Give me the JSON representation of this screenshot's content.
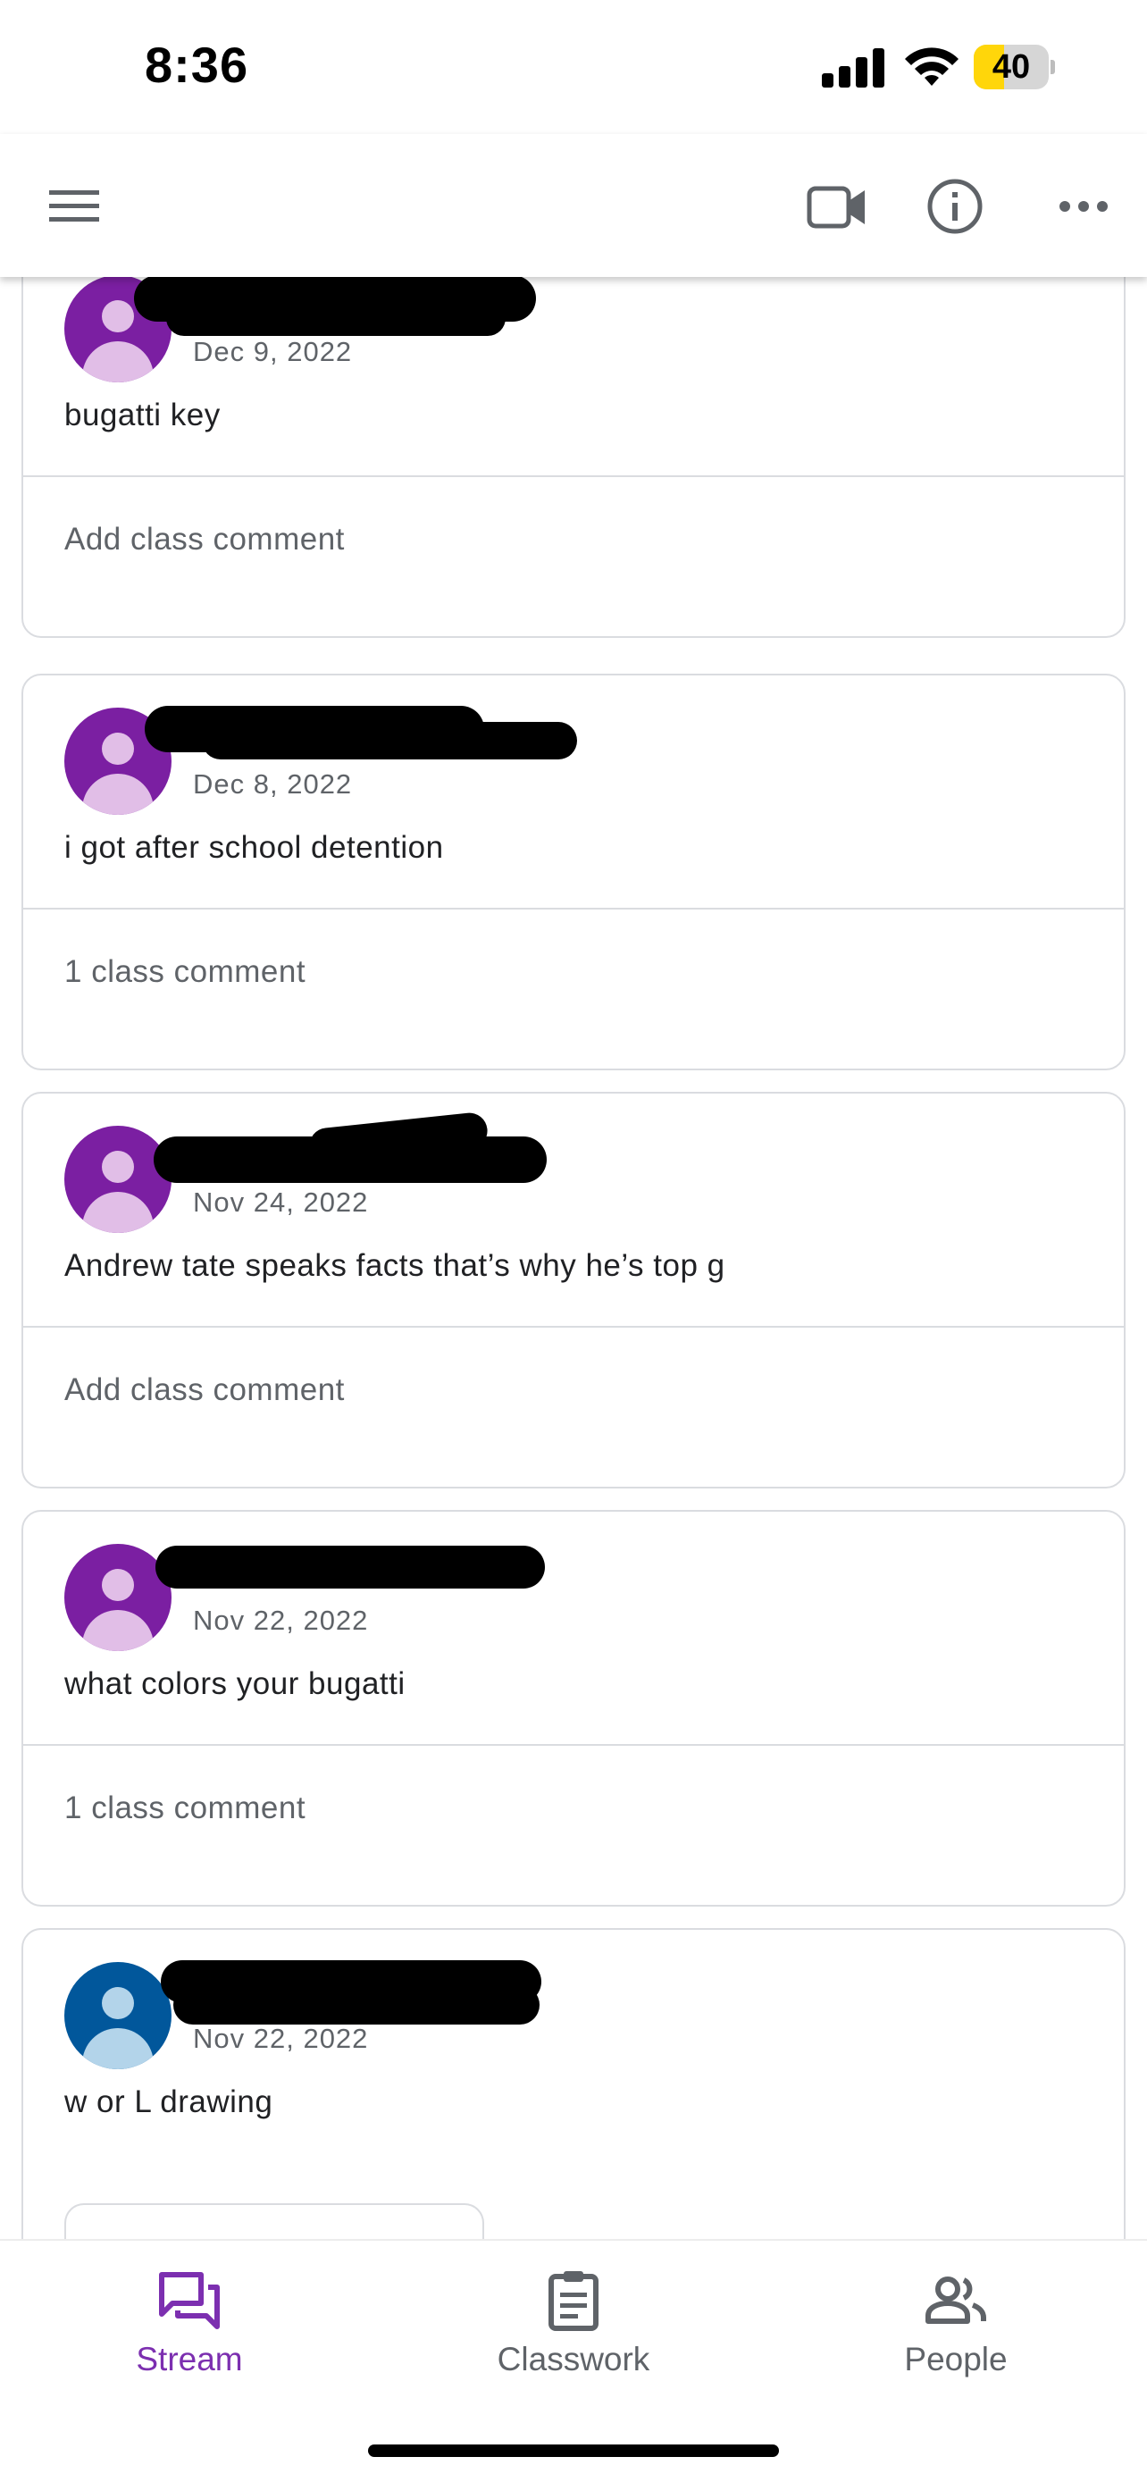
{
  "status_bar": {
    "time": "8:36",
    "battery_level": "40"
  },
  "app_bar": {
    "icons": [
      "menu-icon",
      "video-camera-icon",
      "info-icon",
      "more-horizontal-icon"
    ]
  },
  "posts": [
    {
      "date": "Dec 9, 2022",
      "text": "bugatti key",
      "footer": "Add class comment",
      "avatar_color": "#7b1fa2",
      "avatar_person_color": "#e1bee7"
    },
    {
      "date": "Dec 8, 2022",
      "text": "i got after school detention",
      "footer": "1 class comment",
      "avatar_color": "#7b1fa2",
      "avatar_person_color": "#e1bee7"
    },
    {
      "date": "Nov 24, 2022",
      "text": "Andrew tate speaks facts that’s why he’s top g",
      "footer": "Add class comment",
      "avatar_color": "#7b1fa2",
      "avatar_person_color": "#e1bee7"
    },
    {
      "date": "Nov 22, 2022",
      "text": "what colors your bugatti",
      "footer": "1 class comment",
      "avatar_color": "#7b1fa2",
      "avatar_person_color": "#e1bee7"
    },
    {
      "date": "Nov 22, 2022",
      "text": "w or L drawing",
      "footer": "",
      "avatar_color": "#01579b",
      "avatar_person_color": "#b3d4ea"
    }
  ],
  "bottom_nav": {
    "items": [
      {
        "label": "Stream",
        "icon": "stream-icon",
        "active": true
      },
      {
        "label": "Classwork",
        "icon": "clipboard-icon",
        "active": false
      },
      {
        "label": "People",
        "icon": "people-icon",
        "active": false
      }
    ],
    "active_color": "#7c2fb0"
  }
}
